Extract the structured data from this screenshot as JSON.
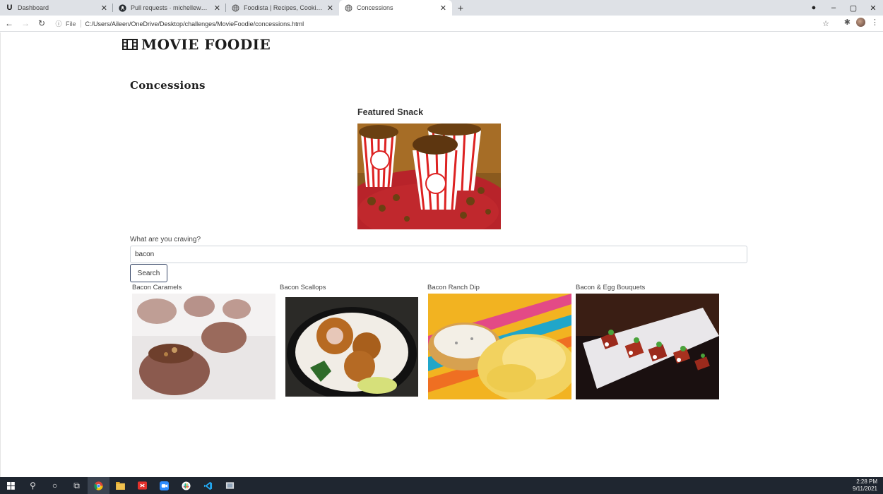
{
  "browser": {
    "tabs": [
      {
        "title": "Dashboard",
        "icon": "u-logo-icon",
        "active": false
      },
      {
        "title": "Pull requests · michellewehr/Mo",
        "icon": "github-icon",
        "active": false
      },
      {
        "title": "Foodista | Recipes, Cooking Tips",
        "icon": "globe-icon",
        "active": false
      },
      {
        "title": "Concessions",
        "icon": "globe-icon",
        "active": true
      }
    ],
    "new_tab": "+",
    "address": {
      "scheme_label": "File",
      "url": "C:/Users/Aileen/OneDrive/Desktop/challenges/MovieFoodie/concessions.html"
    }
  },
  "page": {
    "brand": "MOVIE FOODIE",
    "heading": "Concessions",
    "featured_title": "Featured Snack",
    "search": {
      "label": "What are you craving?",
      "value": "bacon",
      "button": "Search"
    },
    "results": [
      {
        "title": "Bacon Caramels"
      },
      {
        "title": "Bacon Scallops"
      },
      {
        "title": "Bacon Ranch Dip"
      },
      {
        "title": "Bacon & Egg Bouquets"
      }
    ]
  },
  "taskbar": {
    "time": "2:28 PM",
    "date": "9/11/2021"
  },
  "colors": {
    "tabstrip": "#dee1e6",
    "taskbar": "#1f2630",
    "search_button_border": "#3a4a6a"
  }
}
